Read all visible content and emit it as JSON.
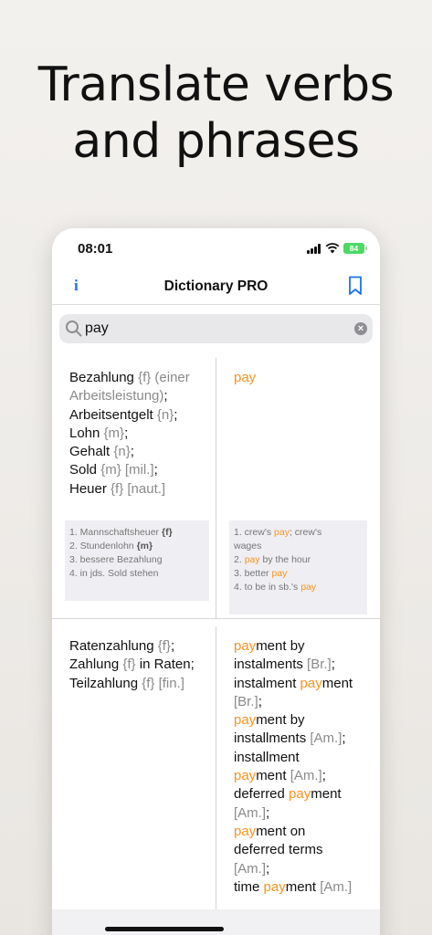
{
  "headline": {
    "line1": "Translate verbs",
    "line2": "and phrases"
  },
  "status_bar": {
    "time": "08:01",
    "battery": "84"
  },
  "navbar": {
    "info_label": "i",
    "title": "Dictionary PRO"
  },
  "search": {
    "value": "pay",
    "placeholder": ""
  },
  "results": [
    {
      "de_lines": [
        [
          {
            "t": "Bezahlung "
          },
          {
            "t": "{f} (einer",
            "c": "g"
          }
        ],
        [
          {
            "t": "Arbeitsleistung)",
            "c": "g"
          },
          {
            "t": ";"
          }
        ],
        [
          {
            "t": "Arbeitsentgelt "
          },
          {
            "t": "{n}",
            "c": "g"
          },
          {
            "t": ";"
          }
        ],
        [
          {
            "t": "Lohn "
          },
          {
            "t": "{m}",
            "c": "g"
          },
          {
            "t": ";"
          }
        ],
        [
          {
            "t": "Gehalt "
          },
          {
            "t": "{n}",
            "c": "g"
          },
          {
            "t": ";"
          }
        ],
        [
          {
            "t": "Sold "
          },
          {
            "t": "{m} [mil.]",
            "c": "g"
          },
          {
            "t": ";"
          }
        ],
        [
          {
            "t": "Heuer "
          },
          {
            "t": "{f} [naut.]",
            "c": "g"
          }
        ]
      ],
      "en_lines": [
        [
          {
            "t": "pay",
            "c": "hl"
          }
        ]
      ],
      "de_examples": [
        [
          {
            "t": "1.  Mannschaftsheuer "
          },
          {
            "t": "{f}",
            "c": "b"
          }
        ],
        [
          {
            "t": "2.  Stundenlohn "
          },
          {
            "t": "{m}",
            "c": "b"
          }
        ],
        [
          {
            "t": "3.  bessere Bezahlung"
          }
        ],
        [
          {
            "t": "4.  in jds. Sold stehen"
          }
        ]
      ],
      "en_examples": [
        [
          {
            "t": "1.  crew's "
          },
          {
            "t": "pay",
            "c": "hl"
          },
          {
            "t": "; crew's"
          }
        ],
        [
          {
            "t": "wages"
          }
        ],
        [
          {
            "t": "2.  "
          },
          {
            "t": "pay",
            "c": "hl"
          },
          {
            "t": " by the hour"
          }
        ],
        [
          {
            "t": "3.  better "
          },
          {
            "t": "pay",
            "c": "hl"
          }
        ],
        [
          {
            "t": "4.  to be in sb.'s "
          },
          {
            "t": "pay",
            "c": "hl"
          }
        ]
      ]
    },
    {
      "de_lines": [
        [
          {
            "t": "Ratenzahlung "
          },
          {
            "t": "{f}",
            "c": "g"
          },
          {
            "t": ";"
          }
        ],
        [
          {
            "t": "Zahlung "
          },
          {
            "t": "{f}",
            "c": "g"
          },
          {
            "t": " in Raten;"
          }
        ],
        [
          {
            "t": "Teilzahlung "
          },
          {
            "t": "{f} [fin.]",
            "c": "g"
          }
        ]
      ],
      "en_lines": [
        [
          {
            "t": "pay",
            "c": "hl"
          },
          {
            "t": "ment by"
          }
        ],
        [
          {
            "t": "instalments "
          },
          {
            "t": "[Br.]",
            "c": "g"
          },
          {
            "t": ";"
          }
        ],
        [
          {
            "t": "instalment "
          },
          {
            "t": "pay",
            "c": "hl"
          },
          {
            "t": "ment"
          }
        ],
        [
          {
            "t": "[Br.]",
            "c": "g"
          },
          {
            "t": ";"
          }
        ],
        [
          {
            "t": "pay",
            "c": "hl"
          },
          {
            "t": "ment by"
          }
        ],
        [
          {
            "t": "installments "
          },
          {
            "t": "[Am.]",
            "c": "g"
          },
          {
            "t": ";"
          }
        ],
        [
          {
            "t": "installment"
          }
        ],
        [
          {
            "t": "pay",
            "c": "hl"
          },
          {
            "t": "ment "
          },
          {
            "t": "[Am.]",
            "c": "g"
          },
          {
            "t": ";"
          }
        ],
        [
          {
            "t": "deferred "
          },
          {
            "t": "pay",
            "c": "hl"
          },
          {
            "t": "ment"
          }
        ],
        [
          {
            "t": "[Am.]",
            "c": "g"
          },
          {
            "t": ";"
          }
        ],
        [
          {
            "t": "pay",
            "c": "hl"
          },
          {
            "t": "ment on"
          }
        ],
        [
          {
            "t": "deferred terms"
          }
        ],
        [
          {
            "t": "[Am.]",
            "c": "g"
          },
          {
            "t": ";"
          }
        ],
        [
          {
            "t": "time "
          },
          {
            "t": "pay",
            "c": "hl"
          },
          {
            "t": "ment "
          },
          {
            "t": "[Am.]",
            "c": "g"
          }
        ]
      ]
    }
  ],
  "colors": {
    "accent": "#1a73e8",
    "highlight": "#f7931e",
    "grammar": "#8a8a8a",
    "battery": "#4cd964"
  },
  "icons": [
    "info-icon",
    "bookmark-icon",
    "search-icon",
    "clear-icon",
    "signal-icon",
    "wifi-icon",
    "battery-icon"
  ]
}
